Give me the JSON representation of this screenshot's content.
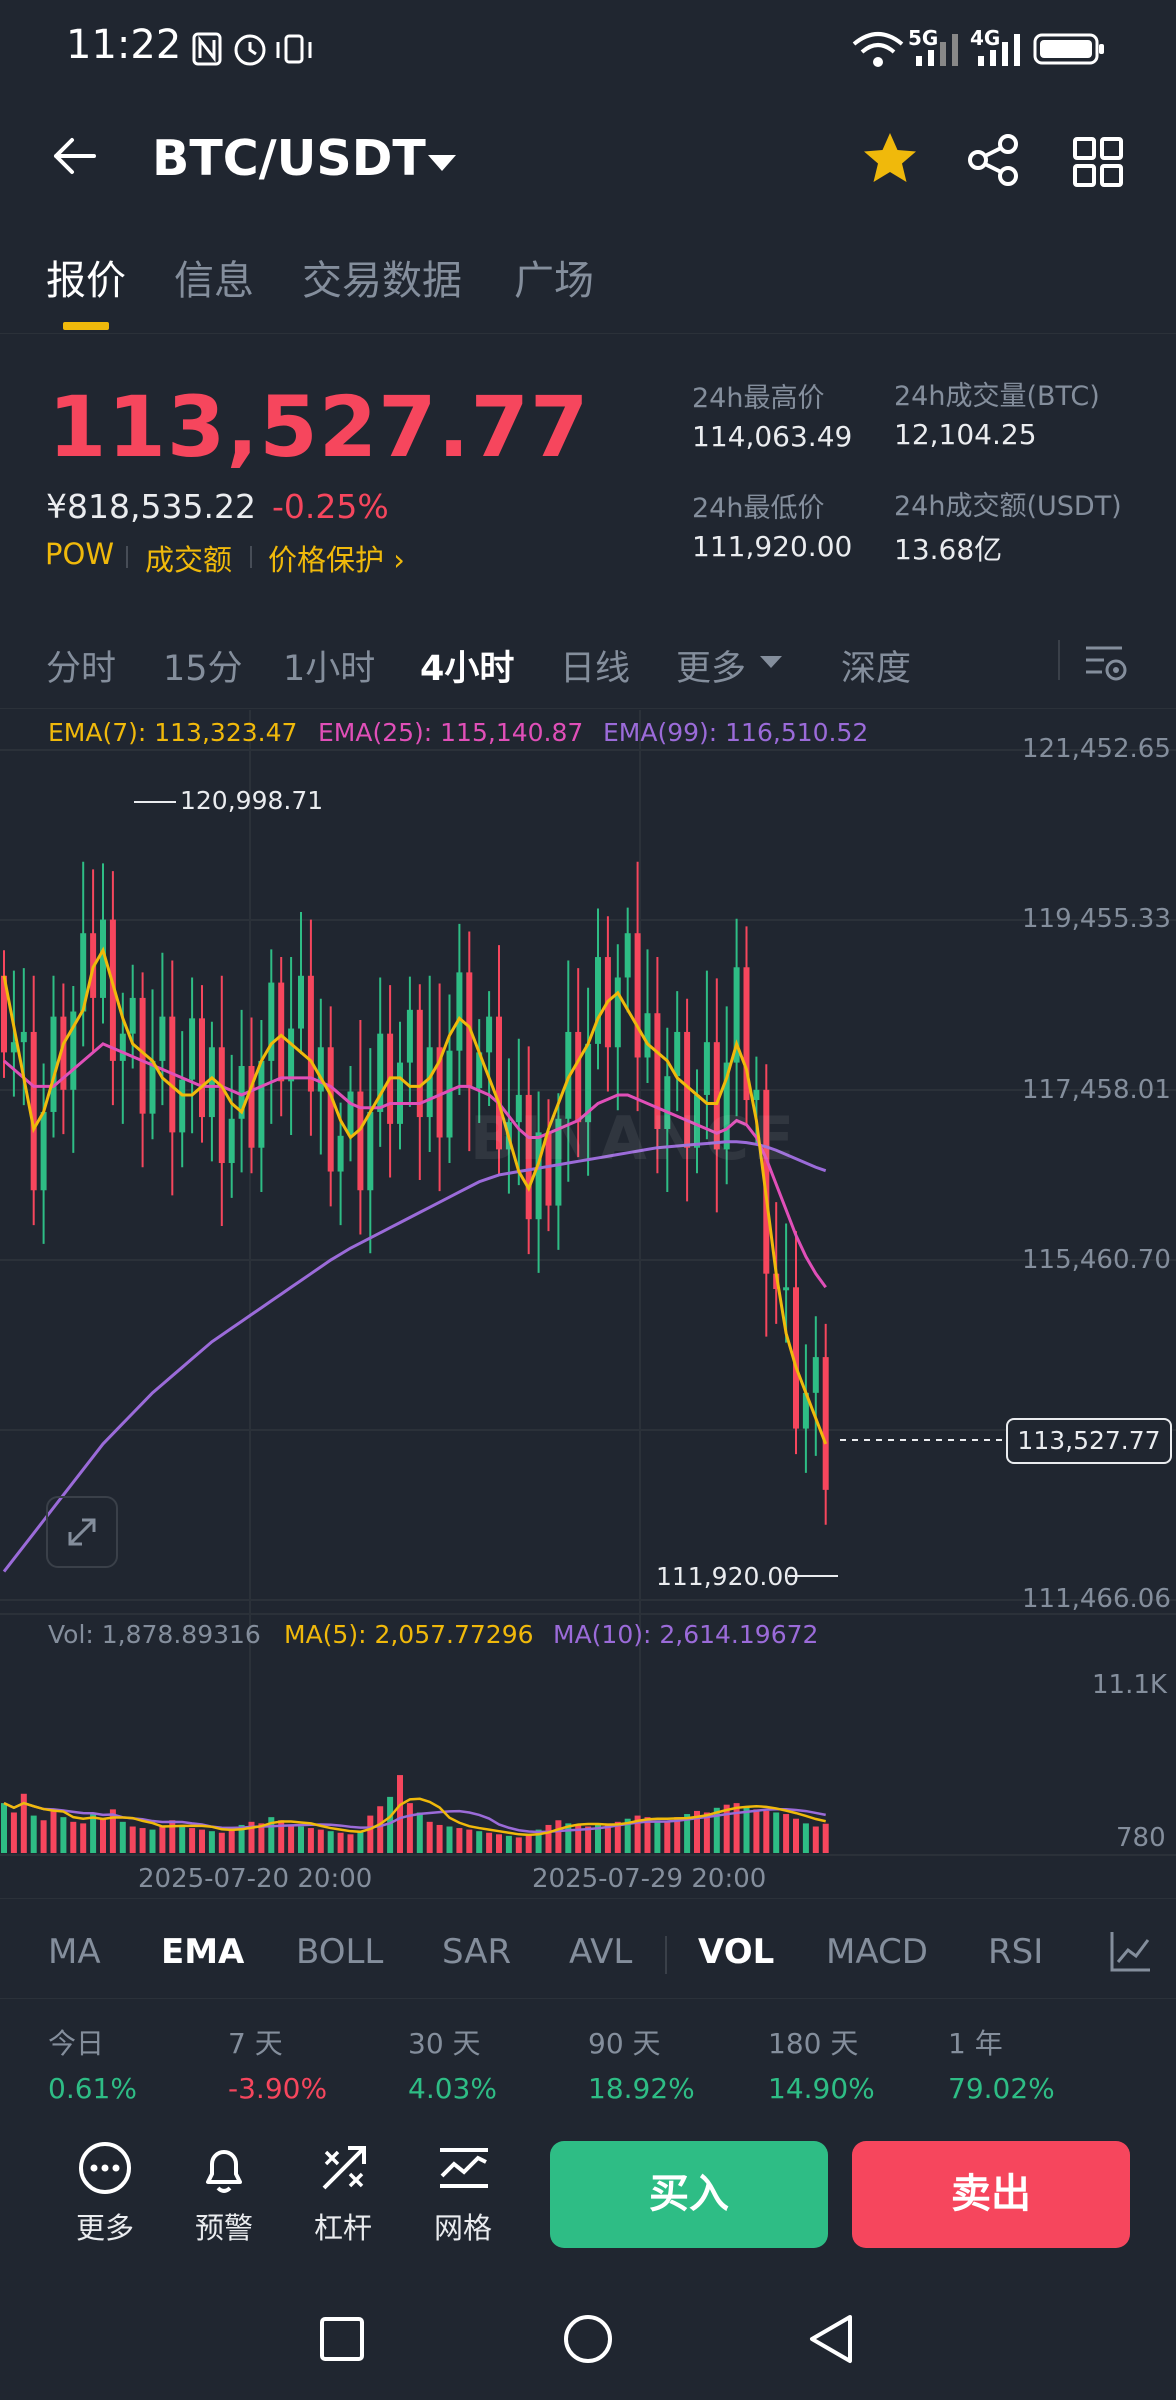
{
  "status_bar": {
    "time": "11:22",
    "net1": "5G",
    "net2": "4G"
  },
  "header": {
    "pair": "BTC/USDT"
  },
  "tabs": [
    "报价",
    "信息",
    "交易数据",
    "广场"
  ],
  "price": {
    "last": "113,527.77",
    "cny": "¥818,535.22",
    "change": "-0.25%",
    "tags": [
      "POW",
      "成交额",
      "价格保护 ›"
    ]
  },
  "stats": {
    "high_label": "24h最高价",
    "high": "114,063.49",
    "low_label": "24h最低价",
    "low": "111,920.00",
    "vol_btc_label": "24h成交量(BTC)",
    "vol_btc": "12,104.25",
    "vol_usdt_label": "24h成交额(USDT)",
    "vol_usdt": "13.68亿"
  },
  "intervals": [
    "分时",
    "15分",
    "1小时",
    "4小时",
    "日线",
    "更多",
    "深度"
  ],
  "ema_legend": {
    "ema7": "EMA(7): 113,323.47",
    "ema25": "EMA(25): 115,140.87",
    "ema99": "EMA(99): 116,510.52"
  },
  "colors": {
    "up": "#2ebd85",
    "down": "#f6465d",
    "ema7": "#f0b90b",
    "ema25": "#e04fb8",
    "ema99": "#9b6bd9",
    "accent": "#f0b90b"
  },
  "chart_data": {
    "type": "candlestick",
    "y_ticks": [
      "121,452.65",
      "119,455.33",
      "117,458.01",
      "115,460.70",
      "111,466.06"
    ],
    "ylim": [
      111466.06,
      121452.65
    ],
    "high_marker": "120,998.71",
    "low_marker": "111,920.00",
    "last_price_label": "113,527.77",
    "watermark": "BINANCE",
    "x_ticks": [
      "2025-07-20 20:00",
      "2025-07-29 20:00"
    ],
    "volume_ticks": [
      "11.1K",
      "780"
    ],
    "ema7": [
      118800,
      118200,
      117600,
      117000,
      117200,
      117600,
      118000,
      118200,
      118400,
      118900,
      119100,
      118700,
      118300,
      118000,
      117900,
      117800,
      117600,
      117500,
      117400,
      117400,
      117500,
      117600,
      117500,
      117300,
      117200,
      117500,
      117800,
      118000,
      118100,
      118000,
      117900,
      117800,
      117600,
      117400,
      117100,
      116900,
      117000,
      117200,
      117400,
      117600,
      117600,
      117500,
      117500,
      117600,
      117800,
      118100,
      118300,
      118200,
      117900,
      117600,
      117300,
      116900,
      116500,
      116300,
      116600,
      117000,
      117300,
      117600,
      117800,
      118000,
      118300,
      118500,
      118600,
      118400,
      118200,
      118000,
      117900,
      117800,
      117600,
      117500,
      117400,
      117300,
      117300,
      117600,
      118000,
      117700,
      117100,
      116200,
      115300,
      114600,
      114200,
      113900,
      113600,
      113300
    ],
    "ema25": [
      117800,
      117700,
      117600,
      117500,
      117500,
      117500,
      117600,
      117700,
      117800,
      117900,
      118000,
      117950,
      117900,
      117850,
      117800,
      117750,
      117700,
      117650,
      117600,
      117550,
      117500,
      117500,
      117500,
      117450,
      117400,
      117450,
      117500,
      117550,
      117600,
      117600,
      117600,
      117600,
      117550,
      117500,
      117400,
      117300,
      117250,
      117250,
      117250,
      117300,
      117300,
      117300,
      117300,
      117350,
      117400,
      117450,
      117500,
      117500,
      117450,
      117400,
      117300,
      117150,
      117000,
      116900,
      116900,
      116950,
      117000,
      117050,
      117100,
      117200,
      117300,
      117350,
      117400,
      117400,
      117350,
      117300,
      117250,
      117200,
      117150,
      117100,
      117050,
      117000,
      116950,
      117000,
      117100,
      117050,
      116900,
      116650,
      116350,
      116050,
      115750,
      115500,
      115300,
      115140
    ],
    "ema99": [
      111800,
      111950,
      112100,
      112250,
      112400,
      112550,
      112700,
      112850,
      113000,
      113150,
      113300,
      113420,
      113540,
      113660,
      113780,
      113900,
      114000,
      114100,
      114200,
      114300,
      114400,
      114500,
      114580,
      114660,
      114740,
      114820,
      114900,
      114980,
      115060,
      115140,
      115220,
      115300,
      115380,
      115460,
      115530,
      115600,
      115660,
      115720,
      115780,
      115840,
      115900,
      115960,
      116020,
      116080,
      116140,
      116200,
      116260,
      116320,
      116380,
      116420,
      116460,
      116480,
      116500,
      116520,
      116540,
      116560,
      116580,
      116600,
      116620,
      116640,
      116660,
      116680,
      116700,
      116720,
      116740,
      116760,
      116780,
      116790,
      116800,
      116810,
      116820,
      116830,
      116840,
      116850,
      116850,
      116840,
      116820,
      116790,
      116750,
      116700,
      116650,
      116600,
      116550,
      116510
    ],
    "volume": [
      3200,
      2600,
      3800,
      2400,
      2100,
      2700,
      2300,
      2000,
      1900,
      2500,
      2200,
      2800,
      2000,
      1700,
      1600,
      1500,
      1700,
      2100,
      1800,
      1600,
      1500,
      1400,
      1300,
      1600,
      1800,
      2000,
      1900,
      2300,
      2100,
      1800,
      1700,
      1600,
      1500,
      1400,
      1300,
      1200,
      1400,
      2400,
      3000,
      3600,
      5000,
      3200,
      2600,
      2000,
      1800,
      1700,
      1600,
      1500,
      1400,
      1300,
      1200,
      1100,
      1000,
      1200,
      1500,
      1800,
      2100,
      1900,
      1800,
      1700,
      1800,
      1900,
      2000,
      2200,
      2400,
      2300,
      2100,
      2000,
      2300,
      2500,
      2700,
      2600,
      2900,
      3100,
      3200,
      3000,
      2800,
      2700,
      2600,
      2500,
      2200,
      1900,
      1700,
      1878.89
    ],
    "vol_ma5": "MA(5): 2,057.77296",
    "vol_ma10": "MA(10): 2,614.19672",
    "vol_label": "Vol: 1,878.89316"
  },
  "indicators": [
    "MA",
    "EMA",
    "BOLL",
    "SAR",
    "AVL",
    "VOL",
    "MACD",
    "RSI"
  ],
  "periods": [
    {
      "label": "今日",
      "value": "0.61%",
      "dir": "up"
    },
    {
      "label": "7 天",
      "value": "-3.90%",
      "dir": "down"
    },
    {
      "label": "30 天",
      "value": "4.03%",
      "dir": "up"
    },
    {
      "label": "90 天",
      "value": "18.92%",
      "dir": "up"
    },
    {
      "label": "180 天",
      "value": "14.90%",
      "dir": "up"
    },
    {
      "label": "1 年",
      "value": "79.02%",
      "dir": "up"
    }
  ],
  "actions": [
    "更多",
    "预警",
    "杠杆",
    "网格"
  ],
  "buy_label": "买入",
  "sell_label": "卖出"
}
